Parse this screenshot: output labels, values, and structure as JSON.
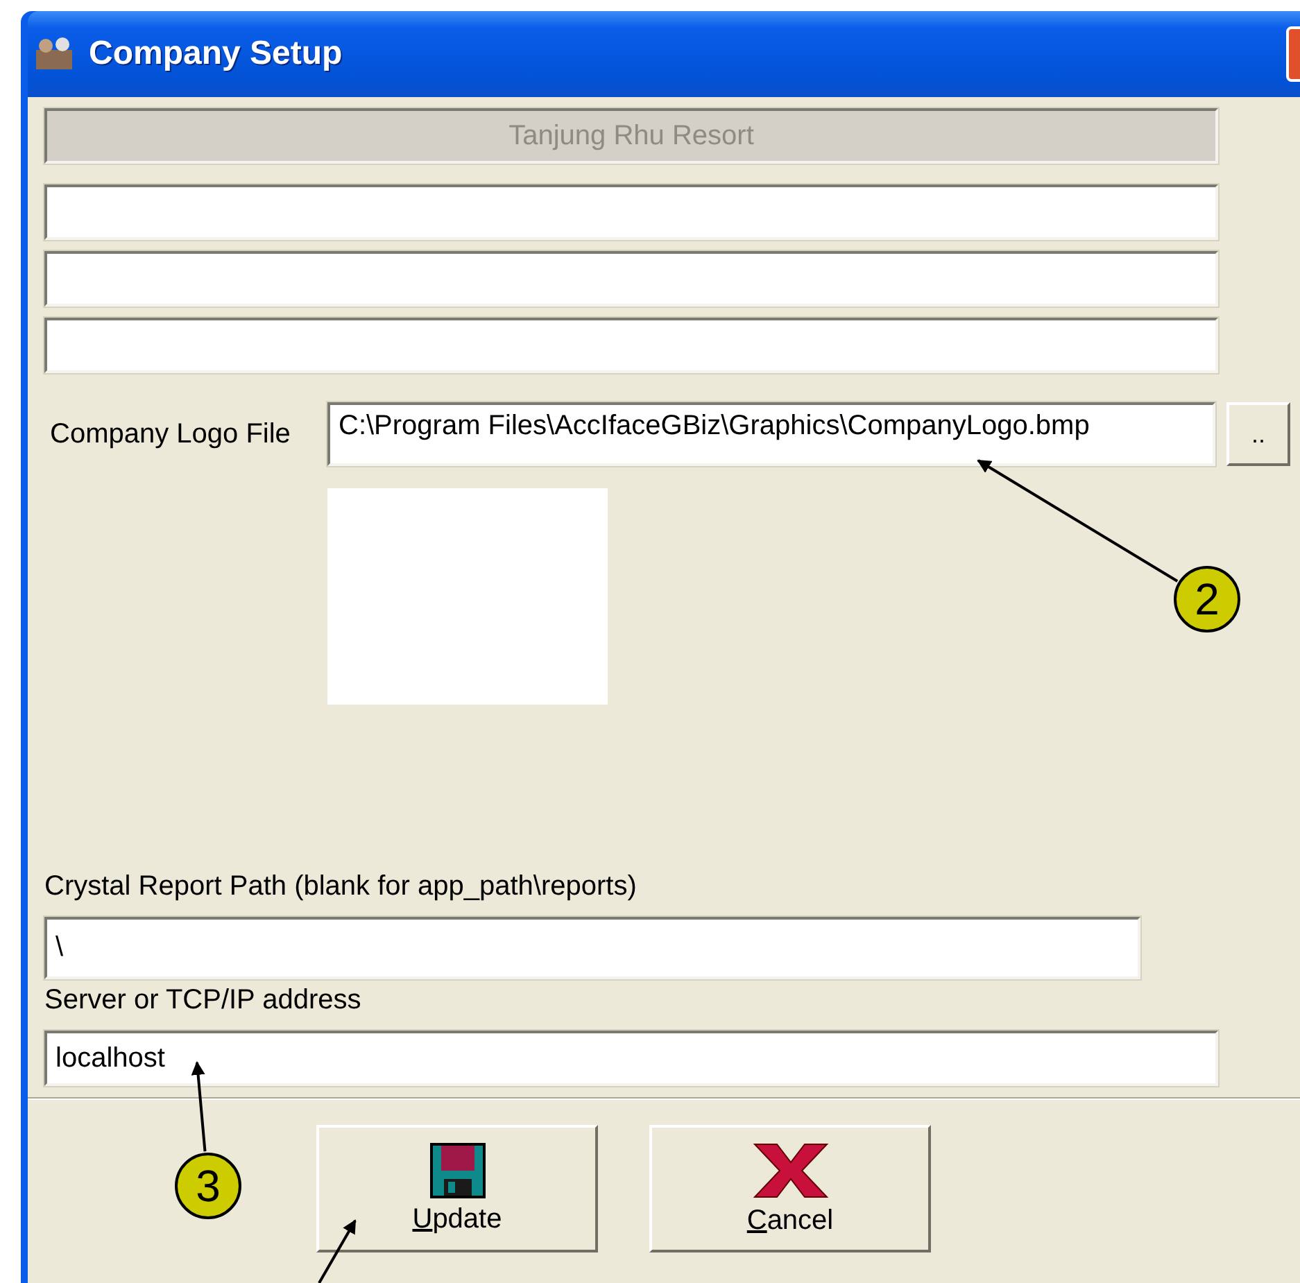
{
  "window": {
    "title": "Company Setup"
  },
  "company_name": {
    "value": "Tanjung Rhu Resort",
    "disabled": true
  },
  "address_fields": [
    {
      "disabled": false
    },
    {
      "disabled": false
    },
    {
      "disabled": false
    }
  ],
  "logo": {
    "label": "Company Logo File",
    "value": "C:\\Program Files\\AccIfaceGBiz\\Graphics\\CompanyLogo.bmp",
    "browse": ".."
  },
  "report_path": {
    "label": "Crystal Report Path (blank for app_path\\reports)",
    "value": "\\"
  },
  "server": {
    "label": "Server or TCP/IP address",
    "value": "localhost"
  },
  "buttons": [
    {
      "kind": "save",
      "label": "Update"
    },
    {
      "kind": "cancel",
      "label": "Cancel"
    }
  ],
  "callouts": [
    {
      "label": "2"
    },
    {
      "label": "3"
    }
  ]
}
